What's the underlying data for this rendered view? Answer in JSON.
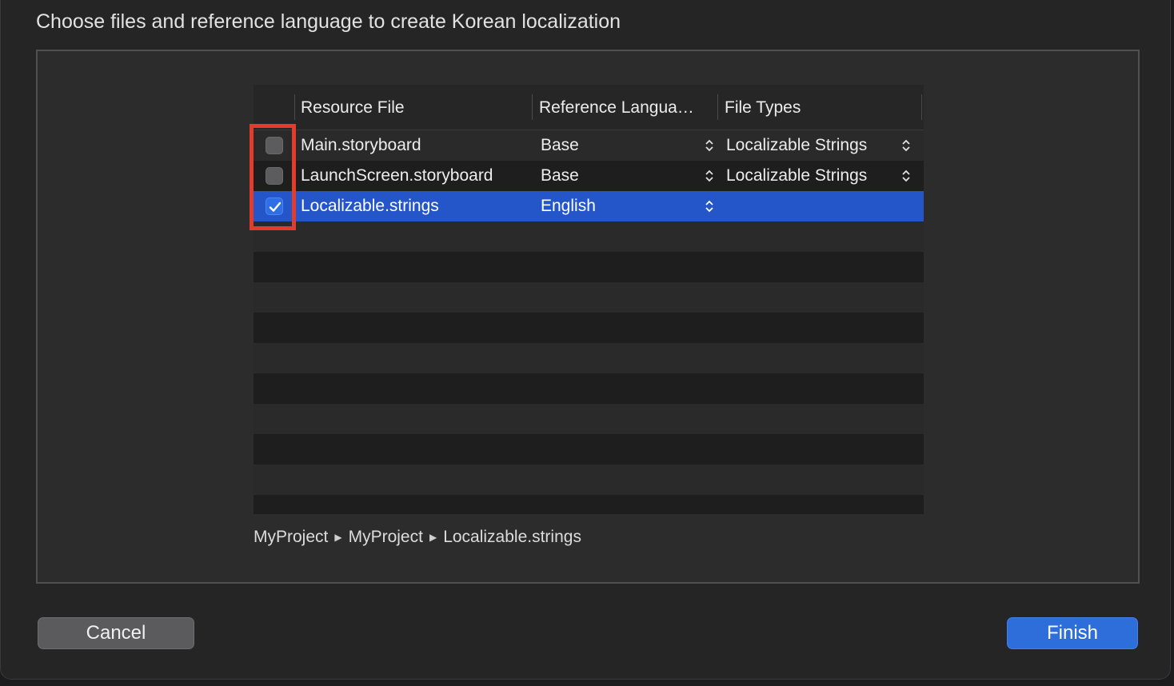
{
  "dialog": {
    "title": "Choose files and reference language to create Korean localization"
  },
  "table": {
    "columns": [
      "Resource File",
      "Reference Langua…",
      "File Types"
    ],
    "rows": [
      {
        "checked": false,
        "file": "Main.storyboard",
        "reference_language": "Base",
        "file_type": "Localizable Strings",
        "selected": false
      },
      {
        "checked": false,
        "file": "LaunchScreen.storyboard",
        "reference_language": "Base",
        "file_type": "Localizable Strings",
        "selected": false
      },
      {
        "checked": true,
        "file": "Localizable.strings",
        "reference_language": "English",
        "file_type": "",
        "selected": true
      }
    ]
  },
  "path_bar": {
    "items": [
      "MyProject",
      "MyProject",
      "Localizable.strings"
    ]
  },
  "buttons": {
    "cancel_label": "Cancel",
    "finish_label": "Finish"
  },
  "colors": {
    "selection": "#2456c9",
    "annotation_box": "#e33b2c",
    "primary_button": "#2e6edb"
  },
  "icons": {
    "stepper": "up-down-chevron-icon",
    "checkmark": "checkmark-icon",
    "path_separator": "triangle-right-icon"
  }
}
